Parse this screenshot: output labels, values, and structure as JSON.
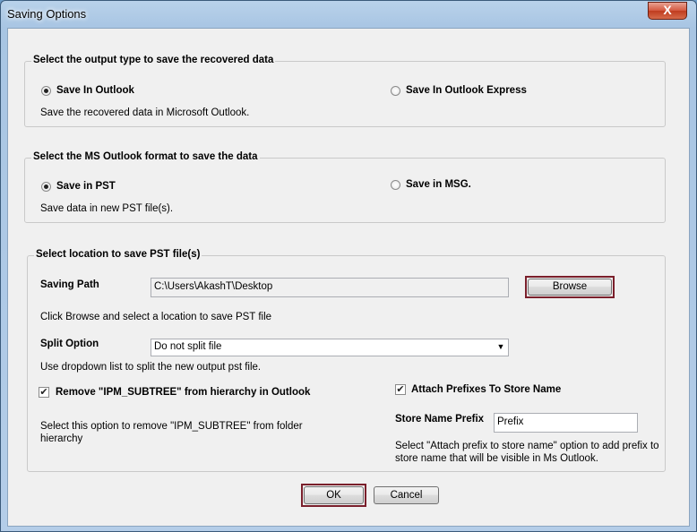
{
  "window": {
    "title": "Saving Options",
    "close_glyph": "X"
  },
  "output_type": {
    "legend": "Select the output type to save the recovered data",
    "option_outlook": "Save In Outlook",
    "option_outlook_express": "Save In Outlook Express",
    "selected": "Save In Outlook",
    "description": "Save the recovered data in Microsoft Outlook."
  },
  "format": {
    "legend": "Select the MS Outlook format to save the data",
    "option_pst": "Save in PST",
    "option_msg": "Save in MSG.",
    "selected": "Save in PST",
    "description": "Save data in new PST file(s)."
  },
  "location": {
    "legend": "Select location to save PST file(s)",
    "saving_path_label": "Saving Path",
    "saving_path_value": "C:\\Users\\AkashT\\Desktop",
    "browse_label": "Browse",
    "browse_hint": "Click Browse and select a location to save PST file",
    "split_label": "Split Option",
    "split_value": "Do not split file",
    "split_hint": "Use dropdown list to split the new output pst file.",
    "remove_ipm_label": "Remove \"IPM_SUBTREE\" from hierarchy in Outlook",
    "remove_ipm_checked": true,
    "remove_ipm_hint_line1": "Select this option to remove \"IPM_SUBTREE\" from folder",
    "remove_ipm_hint_line2": "hierarchy",
    "attach_prefix_label": "Attach Prefixes To Store Name",
    "attach_prefix_checked": true,
    "store_prefix_label": "Store Name Prefix",
    "store_prefix_value": "Prefix",
    "store_prefix_hint_line1": "Select \"Attach prefix to store name\" option to add prefix to",
    "store_prefix_hint_line2": "store name that will be visible in Ms Outlook."
  },
  "footer": {
    "ok_label": "OK",
    "cancel_label": "Cancel"
  },
  "icons": {
    "check": "✔",
    "dropdown": "▼"
  },
  "colors": {
    "highlight_border": "#7a1f2b",
    "client_bg": "#f0f0f0"
  }
}
